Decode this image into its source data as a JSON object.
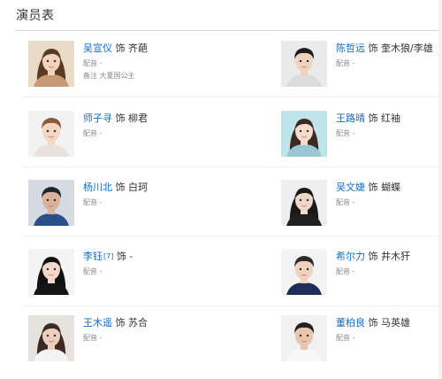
{
  "section": {
    "title": "演员表"
  },
  "cast": [
    {
      "actor": "吴宣仪",
      "as": "饰",
      "role": "齐葩",
      "dub_label": "配音",
      "dub": "-",
      "note_label": "备注",
      "note": "大夏国公主",
      "sup": "",
      "colors": {
        "bg": "#e9dcc6",
        "hair": "#5a3a22",
        "skin": "#f2d3be",
        "cloth": "#c79a74"
      }
    },
    {
      "actor": "陈哲远",
      "as": "饰",
      "role": "奎木狼/李雄",
      "dub_label": "配音",
      "dub": "-",
      "note_label": "",
      "note": "",
      "sup": "",
      "colors": {
        "bg": "#eaeaea",
        "hair": "#1d1d1d",
        "skin": "#f0d2bd",
        "cloth": "#dcdcdc"
      }
    },
    {
      "actor": "师子寻",
      "as": "饰",
      "role": "柳君",
      "dub_label": "配音",
      "dub": "-",
      "note_label": "",
      "note": "",
      "sup": "",
      "colors": {
        "bg": "#f2f2f2",
        "hair": "#8a5a3a",
        "skin": "#f3d7c4",
        "cloth": "#e7e2dc"
      }
    },
    {
      "actor": "王路晴",
      "as": "饰",
      "role": "红袖",
      "dub_label": "配音",
      "dub": "-",
      "note_label": "",
      "note": "",
      "sup": "",
      "colors": {
        "bg": "#bfe4ea",
        "hair": "#3a2a20",
        "skin": "#f4dccd",
        "cloth": "#98c7d6"
      }
    },
    {
      "actor": "杨川北",
      "as": "饰",
      "role": "白珂",
      "dub_label": "配音",
      "dub": "-",
      "note_label": "",
      "note": "",
      "sup": "",
      "colors": {
        "bg": "#d6dbe3",
        "hair": "#22252c",
        "skin": "#d9b39b",
        "cloth": "#2b4f8a"
      }
    },
    {
      "actor": "吴文婕",
      "as": "饰",
      "role": "蝴蝶",
      "dub_label": "配音",
      "dub": "-",
      "note_label": "",
      "note": "",
      "sup": "",
      "colors": {
        "bg": "#eeeeee",
        "hair": "#1a1a1a",
        "skin": "#f0d7c8",
        "cloth": "#1f1f1f"
      }
    },
    {
      "actor": "李钰",
      "as": "饰",
      "role": "-",
      "dub_label": "配音",
      "dub": "-",
      "note_label": "",
      "note": "",
      "sup": "[7]",
      "colors": {
        "bg": "#f4f4f4",
        "hair": "#111111",
        "skin": "#f2d8cb",
        "cloth": "#151515"
      }
    },
    {
      "actor": "希尔力",
      "as": "饰",
      "role": "井木犴",
      "dub_label": "配音",
      "dub": "-",
      "note_label": "",
      "note": "",
      "sup": "",
      "colors": {
        "bg": "#f3f3f3",
        "hair": "#2a2a2a",
        "skin": "#f0d2be",
        "cloth": "#1f2d5a"
      }
    },
    {
      "actor": "王木遥",
      "as": "饰",
      "role": "苏合",
      "dub_label": "配音",
      "dub": "-",
      "note_label": "",
      "note": "",
      "sup": "",
      "colors": {
        "bg": "#e6e2dd",
        "hair": "#3b2b22",
        "skin": "#ecd0bd",
        "cloth": "#f4f4f4"
      }
    },
    {
      "actor": "董柏良",
      "as": "饰",
      "role": "马英雄",
      "dub_label": "配音",
      "dub": "-",
      "note_label": "",
      "note": "",
      "sup": "",
      "colors": {
        "bg": "#f1f1f1",
        "hair": "#202020",
        "skin": "#e7c5ae",
        "cloth": "#f7f7f7"
      }
    }
  ]
}
